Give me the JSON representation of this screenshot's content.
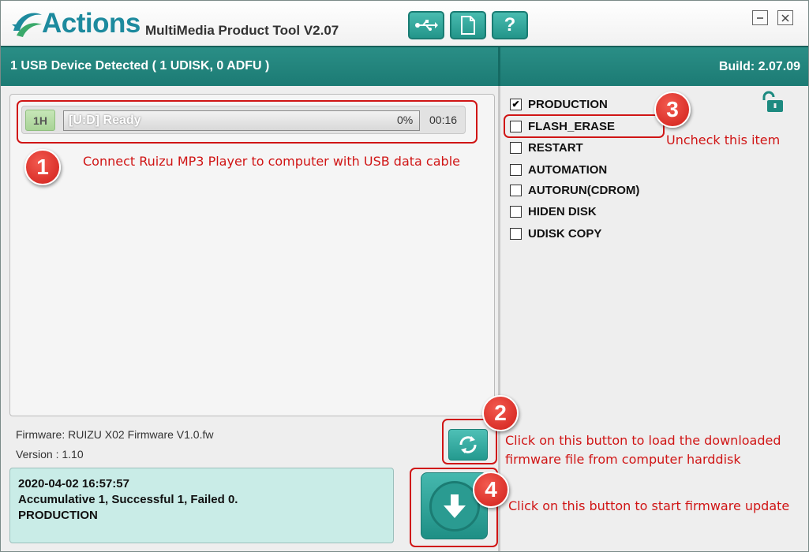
{
  "app": {
    "logo_text": "Actions",
    "title": "MultiMedia Product Tool V2.07"
  },
  "toolbar": {
    "usb_icon": "usb-icon",
    "doc_icon": "document-icon",
    "help_label": "?"
  },
  "window": {
    "min_icon": "minimize-icon",
    "close_icon": "close-icon"
  },
  "header": {
    "device_status": "1 USB Device Detected ( 1 UDISK, 0 ADFU )",
    "build": "Build: 2.07.09"
  },
  "device": {
    "port": "1H",
    "status": "[U:D] Ready",
    "progress_percent": 0,
    "progress_label": "0%",
    "time": "00:16"
  },
  "firmware": {
    "name": "Firmware: RUIZU X02 Firmware V1.0.fw",
    "version": "Version : 1.10"
  },
  "log": {
    "line1": "2020-04-02 16:57:57",
    "line2": "Accumulative 1, Successful 1, Failed 0.",
    "line3": "PRODUCTION"
  },
  "options": [
    {
      "label": "PRODUCTION",
      "checked": true
    },
    {
      "label": "FLASH_ERASE",
      "checked": false
    },
    {
      "label": "RESTART",
      "checked": false
    },
    {
      "label": "AUTOMATION",
      "checked": false
    },
    {
      "label": "AUTORUN(CDROM)",
      "checked": false
    },
    {
      "label": "HIDEN DISK",
      "checked": false
    },
    {
      "label": "UDISK COPY",
      "checked": false
    }
  ],
  "annotations": {
    "step1_num": "1",
    "step1_text": "Connect Ruizu MP3 Player to computer with USB data cable",
    "step2_num": "2",
    "step2_text_line1": "Click on this button to load the downloaded",
    "step2_text_line2": "firmware file from computer harddisk",
    "step3_num": "3",
    "step3_text": "Uncheck this item",
    "step4_num": "4",
    "step4_text": "Click on this button to start firmware update"
  },
  "colors": {
    "teal_header": "#1c7b74",
    "teal_button": "#249a8f",
    "log_bg": "#c9ece7",
    "annotation_red": "#d01515"
  }
}
